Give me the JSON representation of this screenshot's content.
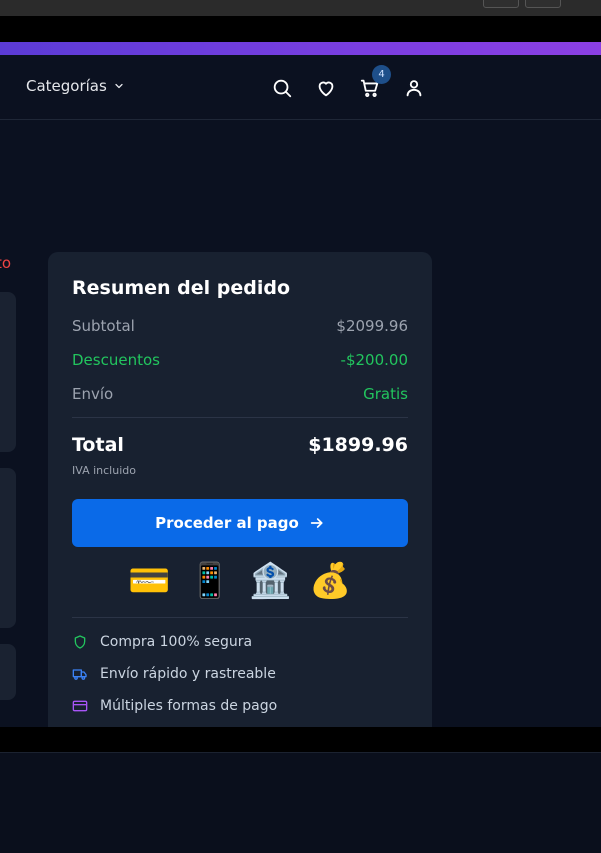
{
  "nav": {
    "categories_label": "Categorías",
    "cart_count": "4",
    "icons": [
      "search-icon",
      "heart-icon",
      "cart-icon",
      "user-icon"
    ]
  },
  "colors": {
    "accent": "#0a6ae8",
    "success": "#22c55e",
    "danger": "#ef4444",
    "card": "#182130",
    "background": "#0b1120"
  },
  "left_partial_text": "to",
  "summary": {
    "title": "Resumen del pedido",
    "subtotal_label": "Subtotal",
    "subtotal_value": "$2099.96",
    "discount_label": "Descuentos",
    "discount_value": "-$200.00",
    "shipping_label": "Envío",
    "shipping_value": "Gratis",
    "total_label": "Total",
    "total_value": "$1899.96",
    "tax_note": "IVA incluido",
    "checkout_label": "Proceder al pago",
    "payment_methods": [
      "💳",
      "📱",
      "🏦",
      "💰"
    ],
    "features": [
      {
        "icon": "shield-icon",
        "text": "Compra 100% segura"
      },
      {
        "icon": "truck-icon",
        "text": "Envío rápido y rastreable"
      },
      {
        "icon": "credit-card-icon",
        "text": "Múltiples formas de pago"
      }
    ]
  }
}
